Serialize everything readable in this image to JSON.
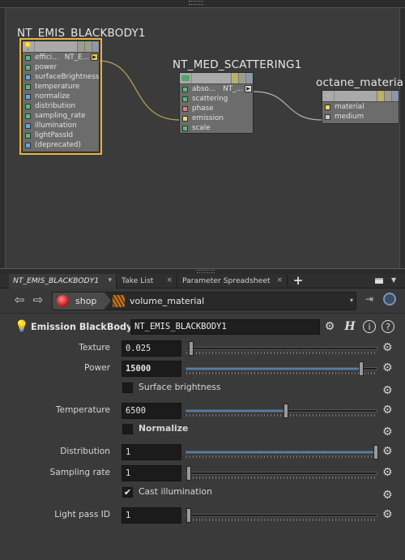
{
  "network": {
    "nodes": [
      {
        "title": "NT_EMIS_BLACKBODY1",
        "selected": true,
        "inputs": [
          {
            "label": "effici...",
            "color": "green",
            "value": "NT_E..."
          },
          {
            "label": "power",
            "color": "green"
          },
          {
            "label": "surfaceBrightness",
            "color": "blue"
          },
          {
            "label": "temperature",
            "color": "green"
          },
          {
            "label": "normalize",
            "color": "blue"
          },
          {
            "label": "distribution",
            "color": "green"
          },
          {
            "label": "sampling_rate",
            "color": "green"
          },
          {
            "label": "illumination",
            "color": "blue"
          },
          {
            "label": "lightPassId",
            "color": "green"
          },
          {
            "label": "(deprecated)",
            "color": "blue"
          }
        ]
      },
      {
        "title": "NT_MED_SCATTERING1",
        "selected": false,
        "inputs": [
          {
            "label": "abso...",
            "color": "green",
            "value": "NT_..."
          },
          {
            "label": "scattering",
            "color": "green"
          },
          {
            "label": "phase",
            "color": "red"
          },
          {
            "label": "emission",
            "color": "yellow"
          },
          {
            "label": "scale",
            "color": "green"
          }
        ]
      },
      {
        "title": "octane_materia",
        "selected": false,
        "inputs": [
          {
            "label": "material",
            "color": "yellow"
          },
          {
            "label": "medium",
            "color": "grey"
          }
        ]
      }
    ]
  },
  "tabs": [
    {
      "label": "NT_EMIS_BLACKBODY1",
      "active": true,
      "close": "▾"
    },
    {
      "label": "Take List",
      "active": false,
      "close": "×"
    },
    {
      "label": "Parameter Spreadsheet",
      "active": false,
      "close": "×"
    }
  ],
  "tab_add": "+",
  "path": {
    "back": "⇦",
    "forward": "⇨",
    "shop": "shop",
    "material": "volume_material",
    "dropdown": "▾"
  },
  "header": {
    "node_type": "Emission BlackBody",
    "node_name": "NT_EMIS_BLACKBODY1",
    "help": "i",
    "question": "?"
  },
  "params": [
    {
      "kind": "slider",
      "label": "Texture",
      "value": "0.025",
      "fraction": 0.025,
      "bold": false,
      "filled": false
    },
    {
      "kind": "slider",
      "label": "Power",
      "value": "15000",
      "fraction": 0.91,
      "bold": true,
      "filled": true
    },
    {
      "kind": "toggle",
      "label": "Surface brightness",
      "checked": false,
      "bold": false
    },
    {
      "kind": "slider",
      "label": "Temperature",
      "value": "6500",
      "fraction": 0.52,
      "bold": false,
      "filled": true
    },
    {
      "kind": "toggle",
      "label": "Normalize",
      "checked": false,
      "bold": true
    },
    {
      "kind": "slider",
      "label": "Distribution",
      "value": "1",
      "fraction": 1.0,
      "bold": false,
      "filled": true
    },
    {
      "kind": "slider",
      "label": "Sampling rate",
      "value": "1",
      "fraction": 0.0,
      "bold": false,
      "filled": false
    },
    {
      "kind": "toggle",
      "label": "Cast illumination",
      "checked": true,
      "bold": false
    },
    {
      "kind": "slider",
      "label": "Light pass ID",
      "value": "1",
      "fraction": 0.0,
      "bold": false,
      "filled": false
    }
  ],
  "colors": {
    "selected_outline": "#e9b33a",
    "slider_fill": "#4d7fb2",
    "wire": "#b8a35a"
  }
}
